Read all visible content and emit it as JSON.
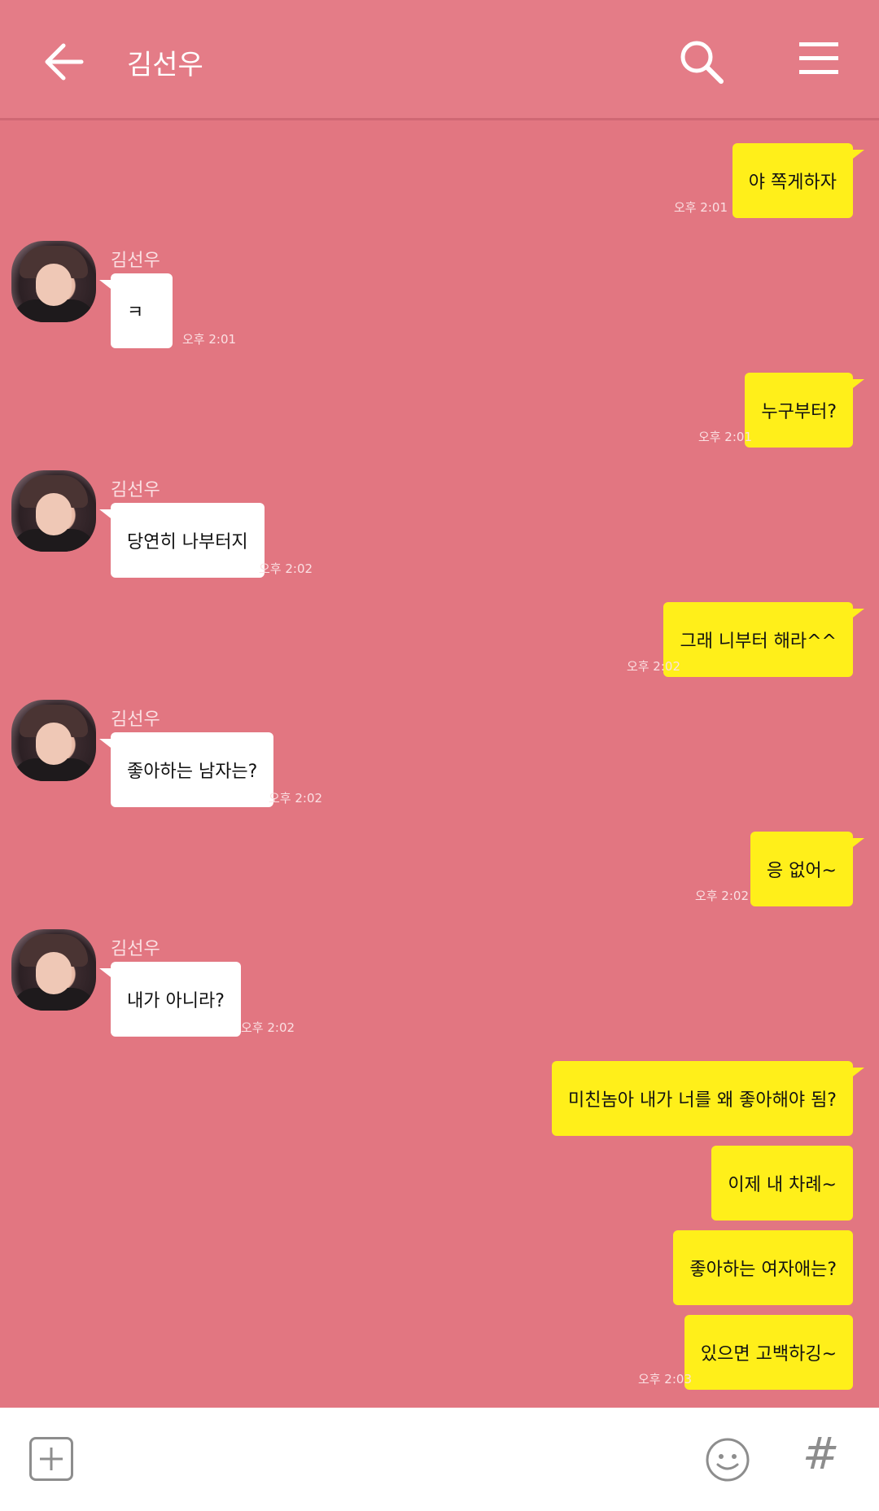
{
  "header": {
    "title": "김선우",
    "back_icon": "back-arrow-icon",
    "search_icon": "search-icon",
    "menu_icon": "hamburger-menu-icon"
  },
  "contact": {
    "name": "김선우"
  },
  "messages": [
    {
      "from": "me",
      "text": "야 쪽게하자",
      "time": "오후 2:01"
    },
    {
      "from": "other",
      "text": "ㅋ",
      "time": "오후 2:01"
    },
    {
      "from": "me",
      "text": "누구부터?",
      "time": "오후 2:01"
    },
    {
      "from": "other",
      "text": "당연히 나부터지",
      "time": "오후 2:02"
    },
    {
      "from": "me",
      "text": "그래 니부터 해라^^",
      "time": "오후 2:02"
    },
    {
      "from": "other",
      "text": "좋아하는 남자는?",
      "time": "오후 2:02"
    },
    {
      "from": "me",
      "text": "응 없어~",
      "time": "오후 2:02"
    },
    {
      "from": "other",
      "text": "내가 아니라?",
      "time": "오후 2:02"
    },
    {
      "from": "me",
      "text": "미친놈아 내가 너를 왜 좋아해야 됨?",
      "time": ""
    },
    {
      "from": "me",
      "text": "이제 내 차례~",
      "time": ""
    },
    {
      "from": "me",
      "text": "좋아하는 여자애는?",
      "time": ""
    },
    {
      "from": "me",
      "text": "있으면 고백하깅~",
      "time": "오후 2:03"
    }
  ],
  "footer": {
    "plus_icon": "plus-icon",
    "emoji_icon": "emoji-icon",
    "hash_icon": "hash-icon",
    "hash_label": "#"
  },
  "colors": {
    "background": "#e27681",
    "header": "#e47c87",
    "my_bubble": "#ffef1a",
    "their_bubble": "#ffffff"
  }
}
